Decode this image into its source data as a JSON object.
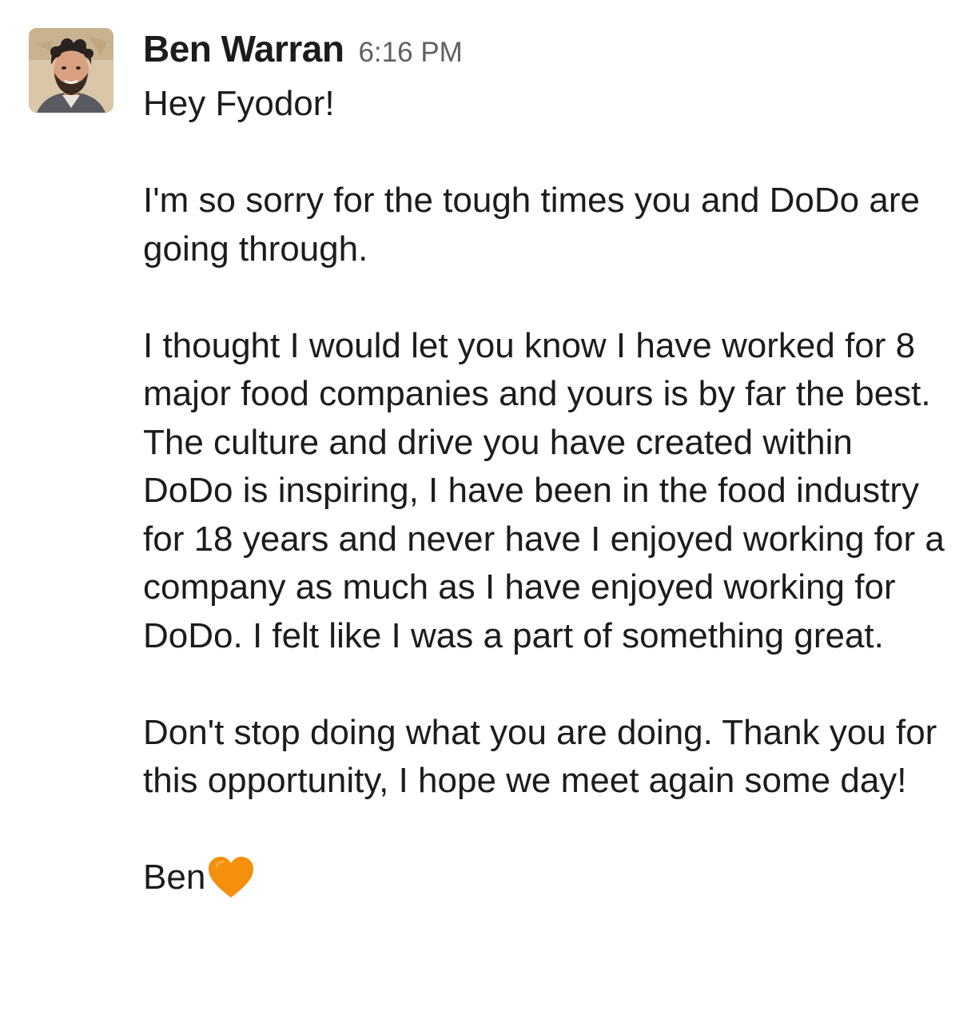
{
  "message": {
    "sender": "Ben Warran",
    "timestamp": "6:16 PM",
    "avatar_icon": "profile-photo",
    "paragraphs": [
      "Hey Fyodor!",
      "I'm so sorry for the tough times you and DoDo are going through.",
      "I thought I would let you know I have worked for 8 major food companies and yours is by far the best. The culture and drive you have created within DoDo is inspiring, I have been in the food industry for 18 years and never have I enjoyed working for a company as much as I have enjoyed working for DoDo. I felt like I was a part of something great.",
      "Don't stop doing what you are doing. Thank you for this opportunity, I hope we meet again some day!"
    ],
    "signature": "Ben",
    "signature_icon": "orange-heart-icon"
  },
  "colors": {
    "text": "#1d1c1d",
    "timestamp": "#616061",
    "heart": "#f4900c"
  }
}
